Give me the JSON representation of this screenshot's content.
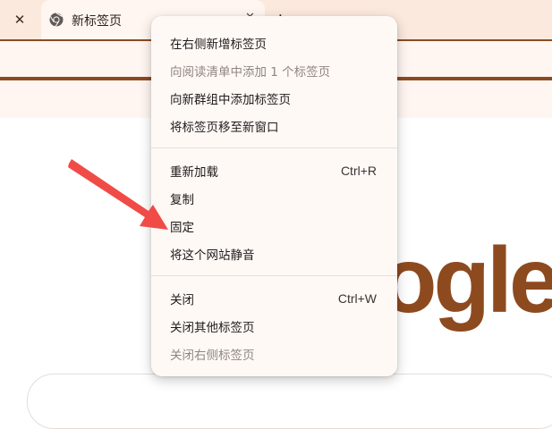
{
  "tabstrip": {
    "close_prev_symbol": "✕",
    "active_tab": {
      "title": "新标签页",
      "icon": "chrome-logo-icon",
      "close_symbol": "✕"
    },
    "new_tab_symbol": "+"
  },
  "page": {
    "logo_fragment": "ogle"
  },
  "context_menu": {
    "groups": [
      {
        "items": [
          {
            "label": "在右侧新增标签页",
            "shortcut": "",
            "enabled": true
          },
          {
            "label": "向阅读清单中添加 1 个标签页",
            "shortcut": "",
            "enabled": false
          },
          {
            "label": "向新群组中添加标签页",
            "shortcut": "",
            "enabled": true
          },
          {
            "label": "将标签页移至新窗口",
            "shortcut": "",
            "enabled": true
          }
        ]
      },
      {
        "items": [
          {
            "label": "重新加载",
            "shortcut": "Ctrl+R",
            "enabled": true
          },
          {
            "label": "复制",
            "shortcut": "",
            "enabled": true
          },
          {
            "label": "固定",
            "shortcut": "",
            "enabled": true
          },
          {
            "label": "将这个网站静音",
            "shortcut": "",
            "enabled": true
          }
        ]
      },
      {
        "items": [
          {
            "label": "关闭",
            "shortcut": "Ctrl+W",
            "enabled": true
          },
          {
            "label": "关闭其他标签页",
            "shortcut": "",
            "enabled": true
          },
          {
            "label": "关闭右侧标签页",
            "shortcut": "",
            "enabled": false
          }
        ]
      }
    ]
  },
  "colors": {
    "tabstrip_bg": "#fce9de",
    "toolbar_bg": "#fff5f1",
    "accent_brown": "#8e4a1f",
    "arrow_red": "#f04b46",
    "menu_bg": "#fff9f6"
  }
}
